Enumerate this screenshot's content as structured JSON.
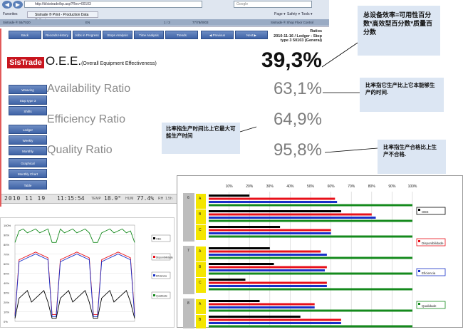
{
  "browser": {
    "url": "http://ti/sistrade/bp.asp?Rec=00103",
    "search": "Google",
    "tab_label": "Sistrade ® Print - Production Data Collect",
    "favorites": "Favorites",
    "cmd_page": "Page ▾",
    "cmd_safety": "Safety ▾",
    "cmd_tools": "Tools ▾",
    "pagebar_left": "Sistrade ® 55/7020",
    "pagebar_mid1": "EN",
    "pagebar_mid2": "1 / 3",
    "pagebar_mid3": "77/78/0003",
    "pagebar_right": "Sistrade ® Shop Floor Control"
  },
  "toolbar": {
    "back": "Back",
    "records_history": "Records History",
    "jobs_in_progress": "Jobs in Progress",
    "stops_analysis": "Stops Analysis",
    "time_analysis": "Time Analysis",
    "trends": "Trends",
    "previous": "Previous",
    "next": "Next"
  },
  "header": {
    "title": "Ratios",
    "line2": "2010-11-16 / Ledger - Stop",
    "line3": "type 3 50103 (General)"
  },
  "logo": "SisTrade",
  "sidebar": [
    "Weaving",
    "Stop type 3",
    "Shifts",
    "Ledger",
    "Weekly",
    "Monthly",
    "Graphical",
    "Monthly Chart",
    "Table"
  ],
  "metrics": {
    "oee_label": "O.E.E.",
    "oee_sub": "(Overall Equipment Effectiveness)",
    "oee_value": "39,3%",
    "availability_label": "Availability Ratio",
    "availability_value": "63,1%",
    "efficiency_label": "Efficiency Ratio",
    "efficiency_value": "64,9%",
    "quality_label": "Quality Ratio",
    "quality_value": "95,8%"
  },
  "notes": {
    "oee": "总设备效率=可用性百分数*高效型百分数*质量百分数",
    "availability": "比率指它生产比上它本能够生产的时间.",
    "efficiency": "比率指生产时间比上它最大可能生产时间",
    "quality": "比率指生产合格比上生产不合格."
  },
  "status": {
    "date": "2010 11 19",
    "time": "11:15:54",
    "temp_label": "TEMP",
    "temp": "18.9°",
    "hum_label": "HUM",
    "hum": "77.4%",
    "extra": "RH",
    "extra2": "1.5h"
  },
  "colors": {
    "oee": "#000000",
    "availability": "#e8101a",
    "efficiency": "#1830c8",
    "quality": "#148a1c"
  },
  "line_chart": {
    "yticks": [
      "100%",
      "90%",
      "80%",
      "70%",
      "60%",
      "50%",
      "40%",
      "30%",
      "20%",
      "10%",
      "0%"
    ],
    "legend": [
      "OEE",
      "Disponibilidade",
      "Eficiencia",
      "Qualidade"
    ]
  },
  "chart_data": {
    "type": "bar",
    "orientation": "horizontal",
    "xticks": [
      "10%",
      "20%",
      "30%",
      "40%",
      "50%",
      "60%",
      "70%",
      "80%",
      "90%",
      "100%"
    ],
    "groups": [
      {
        "label": "6",
        "shifts": [
          {
            "label": "A",
            "values": [
              20,
              62,
              63,
              100
            ]
          },
          {
            "label": "B",
            "values": [
              65,
              80,
              82,
              100
            ]
          },
          {
            "label": "C",
            "values": [
              35,
              60,
              60,
              100
            ]
          }
        ]
      },
      {
        "label": "7",
        "shifts": [
          {
            "label": "A",
            "values": [
              30,
              55,
              58,
              100
            ]
          },
          {
            "label": "B",
            "values": [
              32,
              58,
              57,
              100
            ]
          },
          {
            "label": "C",
            "values": [
              18,
              58,
              58,
              100
            ]
          }
        ]
      },
      {
        "label": "8",
        "shifts": [
          {
            "label": "A",
            "values": [
              25,
              52,
              52,
              100
            ]
          },
          {
            "label": "B",
            "values": [
              45,
              65,
              65,
              100
            ]
          },
          {
            "label": "C",
            "values": [
              28,
              55,
              55,
              100
            ]
          }
        ]
      }
    ],
    "series": [
      {
        "name": "OEE"
      },
      {
        "name": "Disponibilidade"
      },
      {
        "name": "Eficiencia"
      },
      {
        "name": "Qualidade"
      }
    ],
    "xlim": [
      0,
      100
    ]
  }
}
